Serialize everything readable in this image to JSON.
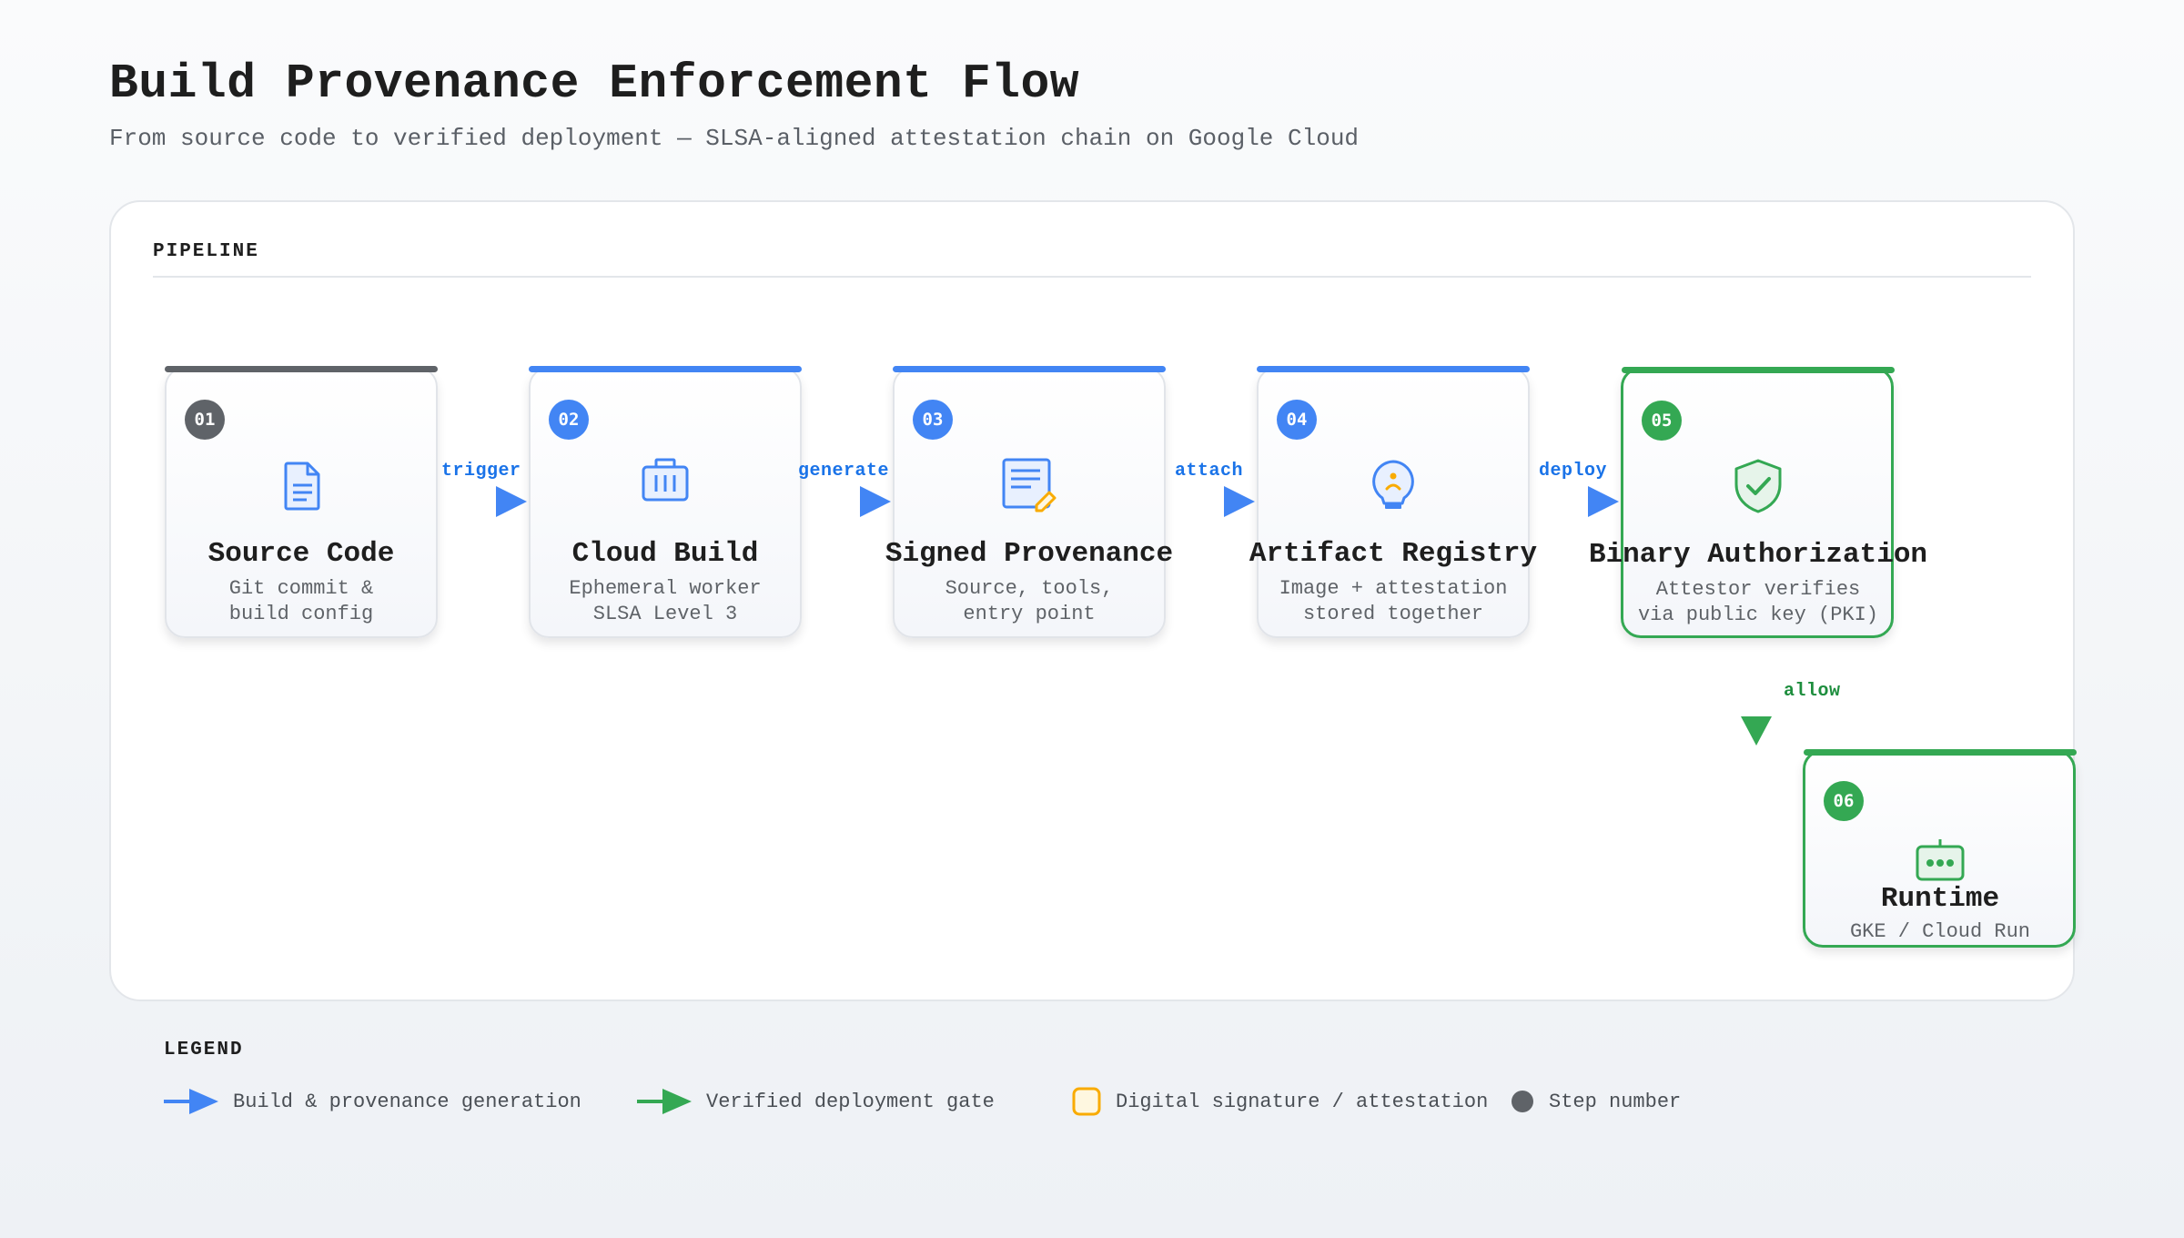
{
  "header": {
    "title": "Build Provenance Enforcement Flow",
    "subtitle": "From source code to verified deployment — SLSA-aligned attestation chain on Google Cloud"
  },
  "panel": {
    "label": "PIPELINE"
  },
  "colors": {
    "blue": "#4285f4",
    "green": "#34a853",
    "gray": "#5f6368",
    "amber": "#f9ab00"
  },
  "steps": [
    {
      "number": "01",
      "title": "Source Code",
      "desc": [
        "Git commit &",
        "build config"
      ],
      "icon": "document-icon",
      "accent": "gray"
    },
    {
      "number": "02",
      "title": "Cloud Build",
      "desc": [
        "Ephemeral worker",
        "SLSA Level 3"
      ],
      "icon": "build-container-icon",
      "accent": "blue"
    },
    {
      "number": "03",
      "title": "Signed Provenance",
      "desc": [
        "Source, tools,",
        "entry point"
      ],
      "icon": "signed-document-icon",
      "accent": "blue"
    },
    {
      "number": "04",
      "title": "Artifact Registry",
      "desc": [
        "Image + attestation",
        "stored together"
      ],
      "icon": "registry-bulb-icon",
      "accent": "blue"
    },
    {
      "number": "05",
      "title": "Binary Authorization",
      "desc": [
        "Attestor verifies",
        "via public key (PKI)"
      ],
      "icon": "shield-check-icon",
      "accent": "green"
    },
    {
      "number": "06",
      "title": "Runtime",
      "desc": [
        "GKE / Cloud Run"
      ],
      "icon": "runtime-container-icon",
      "accent": "green"
    }
  ],
  "connectors": [
    {
      "label": "trigger",
      "kind": "build"
    },
    {
      "label": "generate",
      "kind": "build"
    },
    {
      "label": "attach",
      "kind": "build"
    },
    {
      "label": "deploy",
      "kind": "build"
    },
    {
      "label": "allow",
      "kind": "verified"
    }
  ],
  "legend": {
    "title": "LEGEND",
    "items": [
      {
        "label": "Build & provenance generation",
        "icon": "blue-arrow-icon"
      },
      {
        "label": "Verified deployment gate",
        "icon": "green-arrow-icon"
      },
      {
        "label": "Digital signature / attestation",
        "icon": "amber-square-icon"
      },
      {
        "label": "Step number",
        "icon": "gray-dot-icon"
      }
    ]
  }
}
